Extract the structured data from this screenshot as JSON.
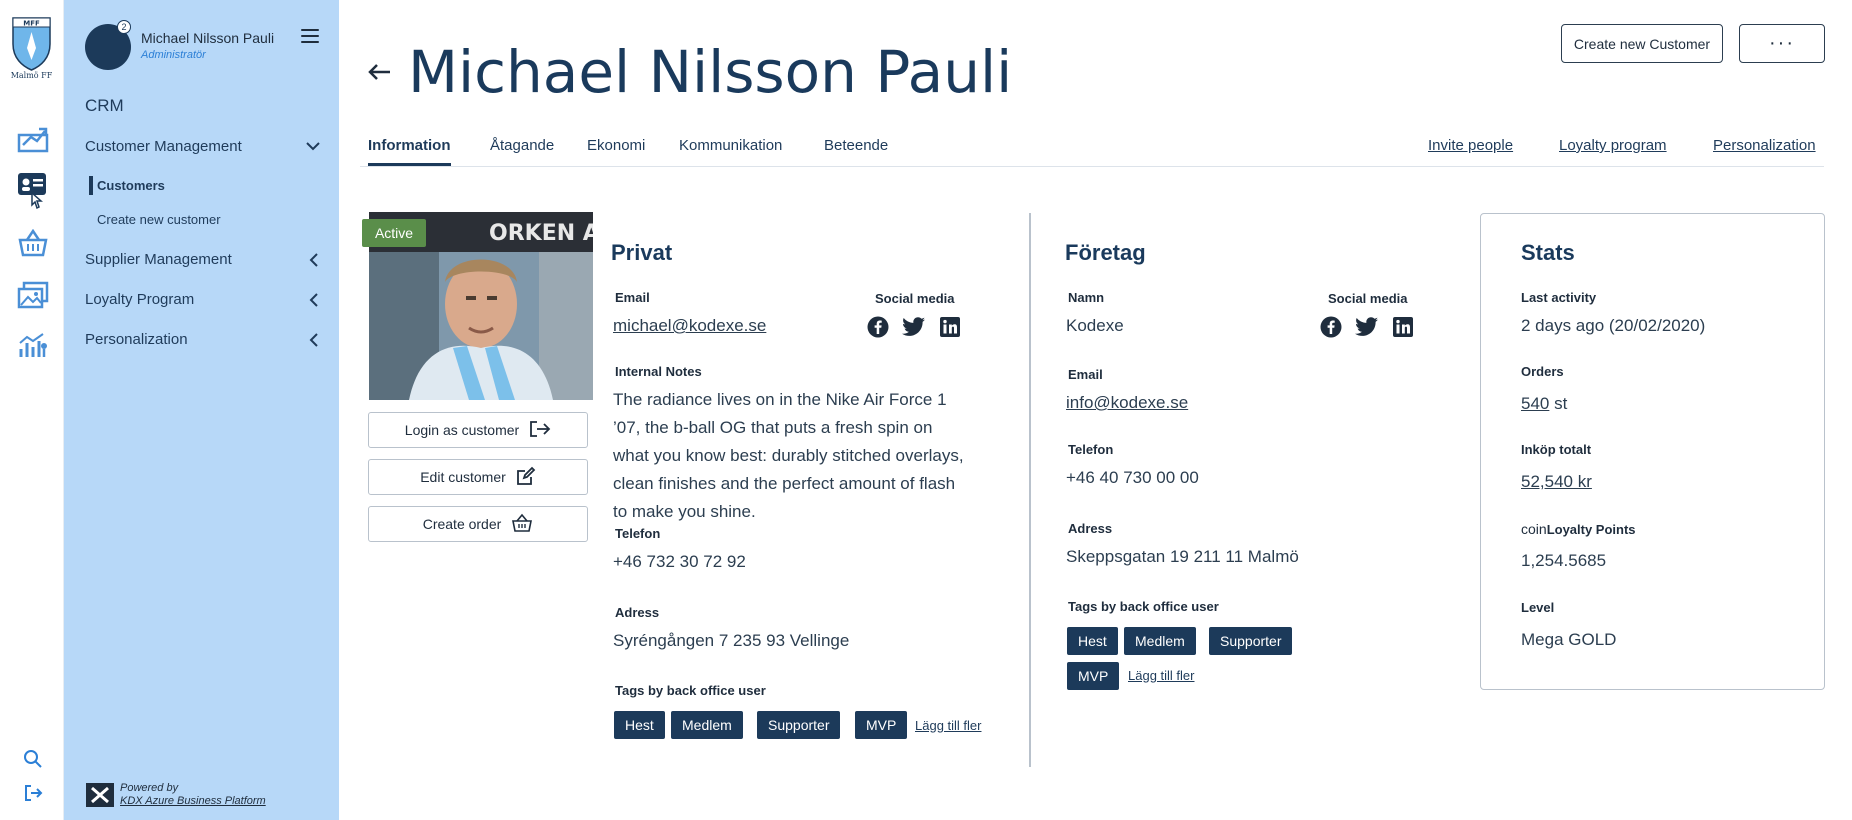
{
  "rail": {
    "logo_caption": "Malmö FF",
    "logo_letters": "MFF"
  },
  "user": {
    "name": "Michael Nilsson Pauli",
    "role": "Administratör",
    "badge": "2"
  },
  "nav": {
    "section": "CRM",
    "items": [
      {
        "label": "Customer Management",
        "expanded": true
      },
      {
        "label": "Supplier Management",
        "expanded": false
      },
      {
        "label": "Loyalty Program",
        "expanded": false
      },
      {
        "label": "Personalization",
        "expanded": false
      }
    ],
    "sub_items": [
      {
        "label": "Customers",
        "active": true
      },
      {
        "label": "Create new customer",
        "active": false
      }
    ],
    "powered_by": "Powered by",
    "powered_link": "KDX Azure Business Platform"
  },
  "header": {
    "title": "Michael Nilsson Pauli",
    "create_button": "Create new Customer",
    "more_button": "···"
  },
  "tabs": {
    "items": [
      "Information",
      "Åtagande",
      "Ekonomi",
      "Kommunikation",
      "Beteende"
    ],
    "active": "Information",
    "links": [
      "Invite people",
      "Loyalty program",
      "Personalization"
    ]
  },
  "profile": {
    "status": "Active",
    "actions": [
      "Login as customer",
      "Edit customer",
      "Create order"
    ]
  },
  "privat": {
    "title": "Privat",
    "email_label": "Email",
    "email": "michael@kodexe.se",
    "social_label": "Social media",
    "notes_label": "Internal Notes",
    "notes": "The radiance lives on in the Nike Air Force 1 ’07, the b-ball OG that puts a fresh spin on what you know best: durably stitched overlays, clean finishes and the perfect amount of flash to make you shine.",
    "phone_label": "Telefon",
    "phone": "+46 732 30 72 92",
    "address_label": "Adress",
    "address": "Syréngången 7 235 93 Vellinge",
    "tags_label": "Tags by back office user",
    "tags": [
      "Hest",
      "Medlem",
      "Supporter",
      "MVP"
    ],
    "add_tag": "Lägg till fler"
  },
  "foretag": {
    "title": "Företag",
    "name_label": "Namn",
    "name": "Kodexe",
    "social_label": "Social media",
    "email_label": "Email",
    "email": "info@kodexe.se",
    "phone_label": "Telefon",
    "phone": "+46 40 730 00 00",
    "address_label": "Adress",
    "address": "Skeppsgatan 19 211 11 Malmö",
    "tags_label": "Tags by back office user",
    "tags": [
      "Hest",
      "Medlem",
      "Supporter",
      "MVP"
    ],
    "add_tag": "Lägg till fler"
  },
  "stats": {
    "title": "Stats",
    "last_activity_label": "Last activity",
    "last_activity": "2 days ago (20/02/2020)",
    "orders_label": "Orders",
    "orders_count": "540",
    "orders_unit": "st",
    "total_label": "Inköp totalt",
    "total": "52,540 kr",
    "points_prefix": "coin",
    "points_label": "Loyalty Points",
    "points": "1,254.5685",
    "level_label": "Level",
    "level": "Mega GOLD"
  },
  "colors": {
    "nav_bg": "#b7d8f8",
    "primary": "#1c3a5a",
    "active_badge": "#5a8e4a",
    "rail_icon": "#4a8fd6"
  }
}
